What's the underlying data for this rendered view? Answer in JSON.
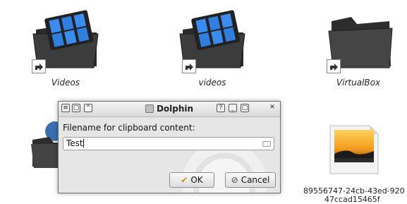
{
  "desktop": {
    "items": [
      {
        "label": "Videos"
      },
      {
        "label": "videos"
      },
      {
        "label": "VirtualBox"
      },
      {
        "label_line1": "89556747-24cb-43ed-920",
        "label_line2": "47ccad15465f"
      }
    ]
  },
  "dialog": {
    "title": "Dolphin",
    "prompt": "Filename for clipboard content:",
    "input_value": "Test",
    "ok_label": "OK",
    "cancel_label": "Cancel",
    "help_glyph": "?",
    "minimize_glyph": "_",
    "maximize_glyph": "□",
    "close_glyph": "✕",
    "menu_glyph": "≡",
    "onalltop_glyph": "▢",
    "shade_glyph": "^"
  },
  "colors": {
    "folder_dark": "#3a3a3a",
    "film_blue": "#2f7fe0",
    "dialog_bg": "#e9e9e9",
    "sunset_orange": "#f29a1a"
  },
  "icons": [
    "video-folder-icon",
    "folder-icon",
    "shortcut-arrow-icon",
    "image-file-icon",
    "ok-check-icon",
    "cancel-icon"
  ]
}
